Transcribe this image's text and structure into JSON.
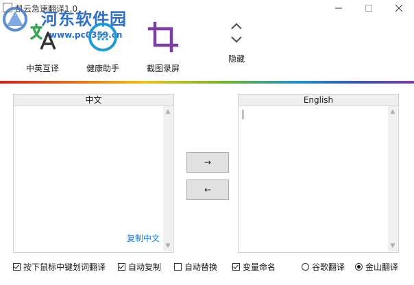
{
  "window": {
    "title": "凯云急速翻译1.0",
    "watermark_line1": "河东软件园",
    "watermark_line2": "www.pc0359.cn"
  },
  "toolbar": {
    "translate_label": "中英互译",
    "health_label": "健康助手",
    "capture_label": "截图录屏",
    "hide_label": "隐藏"
  },
  "colors": {
    "translate_icon": "#3aa655",
    "health_icon": "#1e9ad6",
    "capture_icon": "#7b3fa0",
    "link": "#1a7ad9"
  },
  "left_panel": {
    "header": "中文",
    "text": "",
    "copy_link": "复制中文"
  },
  "right_panel": {
    "header": "English",
    "text": ""
  },
  "buttons": {
    "to_english": "→",
    "to_chinese": "←"
  },
  "options": [
    {
      "label": "按下鼠标中键划词翻译",
      "checked": true
    },
    {
      "label": "自动复制",
      "checked": true
    },
    {
      "label": "自动替换",
      "checked": false
    },
    {
      "label": "变量命名",
      "checked": true
    }
  ],
  "engines": [
    {
      "label": "谷歌翻译",
      "selected": false
    },
    {
      "label": "金山翻译",
      "selected": true
    }
  ]
}
